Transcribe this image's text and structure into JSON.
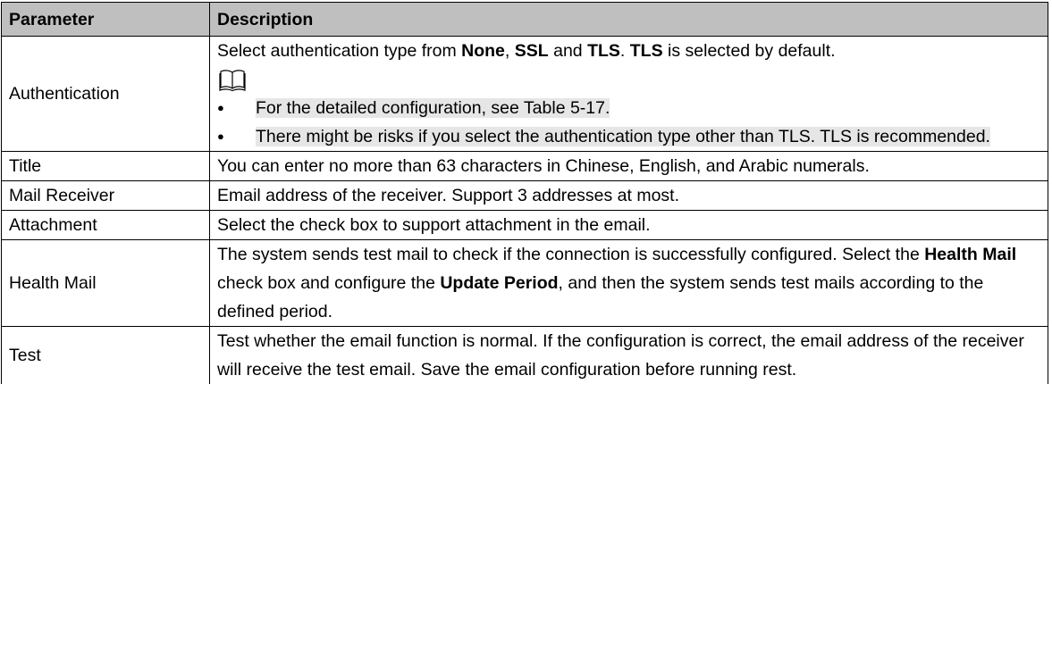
{
  "table": {
    "header": {
      "parameter": "Parameter",
      "description": "Description"
    },
    "authentication": {
      "name": "Authentication",
      "seg1": "Select authentication type from ",
      "none": "None",
      "seg2": ", ",
      "ssl": "SSL",
      "seg3": " and ",
      "tls1": "TLS",
      "seg4": ". ",
      "tls2": "TLS",
      "seg5": " is selected by default.",
      "notes": [
        "For the detailed configuration, see Table 5-17.",
        "There might be risks if you select the authentication type other than TLS. TLS is recommended."
      ]
    },
    "title": {
      "name": "Title",
      "desc": "You can enter no more than 63 characters in Chinese, English, and Arabic numerals."
    },
    "mail_receiver": {
      "name": "Mail Receiver",
      "desc": "Email address of the receiver. Support 3 addresses at most."
    },
    "attachment": {
      "name": "Attachment",
      "desc": "Select the check box to support attachment in the email."
    },
    "health_mail": {
      "name": "Health Mail",
      "seg1": "The system sends test mail to check if the connection is successfully configured. Select the ",
      "bold1": "Health Mail",
      "seg2": " check box and configure the ",
      "bold2": "Update Period",
      "seg3": ", and then the system sends test mails according to the defined period."
    },
    "test": {
      "name": "Test",
      "desc": "Test whether the email function is normal. If the configuration is correct, the email address of the receiver will receive the test email. Save the email configuration before running rest."
    }
  },
  "icons": {
    "note": "book-icon"
  }
}
